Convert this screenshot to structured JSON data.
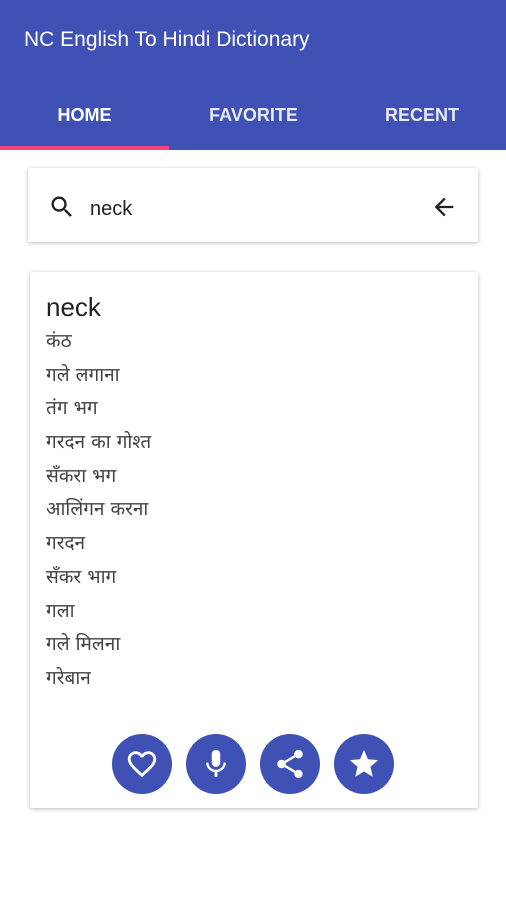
{
  "app": {
    "title": "NC English To Hindi Dictionary"
  },
  "tabs": [
    {
      "label": "HOME"
    },
    {
      "label": "FAVORITE"
    },
    {
      "label": "RECENT"
    }
  ],
  "search": {
    "value": "neck"
  },
  "result": {
    "word": "neck",
    "meanings": [
      "कंठ",
      "गले लगाना",
      "तंग भग",
      "गरदन का गोश्त",
      "सँकरा भग",
      "आलिंगन करना",
      "गरदन",
      "सँकर भाग",
      "गला",
      "गले मिलना",
      "गरेबान"
    ]
  },
  "actions": [
    {
      "icon": "heart-icon"
    },
    {
      "icon": "microphone-icon"
    },
    {
      "icon": "share-icon"
    },
    {
      "icon": "star-icon"
    }
  ],
  "colors": {
    "primary": "#3f51b5",
    "accent": "#ff4081"
  }
}
